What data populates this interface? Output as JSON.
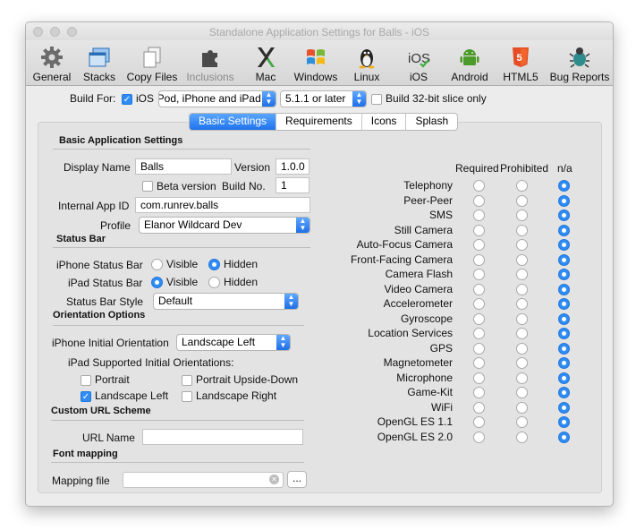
{
  "window": {
    "title": "Standalone Application Settings for Balls - iOS"
  },
  "toolbar": [
    {
      "label": "General",
      "icon": "gear-icon",
      "enabled": true
    },
    {
      "label": "Stacks",
      "icon": "stacks-icon",
      "enabled": true
    },
    {
      "label": "Copy Files",
      "icon": "copy-files-icon",
      "enabled": true
    },
    {
      "label": "Inclusions",
      "icon": "puzzle-icon",
      "enabled": false
    },
    {
      "label": "Mac",
      "icon": "mac-x-icon",
      "enabled": true
    },
    {
      "label": "Windows",
      "icon": "windows-icon",
      "enabled": true
    },
    {
      "label": "Linux",
      "icon": "linux-penguin-icon",
      "enabled": true
    },
    {
      "label": "iOS",
      "icon": "ios-icon",
      "enabled": true
    },
    {
      "label": "Android",
      "icon": "android-icon",
      "enabled": true
    },
    {
      "label": "HTML5",
      "icon": "html5-icon",
      "enabled": true
    },
    {
      "label": "Bug Reports",
      "icon": "bug-icon",
      "enabled": true
    }
  ],
  "build": {
    "label": "Build For:",
    "ios_label": "iOS",
    "device_value": "iPod, iPhone and iPad",
    "version_value": "5.1.1 or later",
    "slice_label": "Build 32-bit slice only"
  },
  "tabs": [
    "Basic Settings",
    "Requirements",
    "Icons",
    "Splash"
  ],
  "basic": {
    "heading": "Basic Application Settings",
    "display_name_label": "Display Name",
    "display_name_value": "Balls",
    "version_label": "Version",
    "version_value": "1.0.0",
    "beta_label": "Beta version",
    "build_no_label": "Build No.",
    "build_no_value": "1",
    "app_id_label": "Internal App ID",
    "app_id_value": "com.runrev.balls",
    "profile_label": "Profile",
    "profile_value": "Elanor Wildcard Dev"
  },
  "status_bar": {
    "heading": "Status Bar",
    "iphone_label": "iPhone Status Bar",
    "ipad_label": "iPad Status Bar",
    "visible_label": "Visible",
    "hidden_label": "Hidden",
    "style_label": "Status Bar Style",
    "style_value": "Default"
  },
  "orientation": {
    "heading": "Orientation Options",
    "iphone_initial_label": "iPhone Initial Orientation",
    "iphone_initial_value": "Landscape Left",
    "ipad_supported_label": "iPad Supported Initial Orientations:",
    "portrait": "Portrait",
    "portrait_upside_down": "Portrait Upside-Down",
    "landscape_left": "Landscape Left",
    "landscape_right": "Landscape Right"
  },
  "url_scheme": {
    "heading": "Custom URL Scheme",
    "url_name_label": "URL Name"
  },
  "font_mapping": {
    "heading": "Font mapping",
    "mapping_file_label": "Mapping file",
    "browse_label": "..."
  },
  "requirements": {
    "columns": [
      "Required",
      "Prohibited",
      "n/a"
    ],
    "rows": [
      "Telephony",
      "Peer-Peer",
      "SMS",
      "Still Camera",
      "Auto-Focus Camera",
      "Front-Facing Camera",
      "Camera Flash",
      "Video Camera",
      "Accelerometer",
      "Gyroscope",
      "Location Services",
      "GPS",
      "Magnetometer",
      "Microphone",
      "Game-Kit",
      "WiFi",
      "OpenGL ES 1.1",
      "OpenGL ES 2.0"
    ]
  },
  "colors": {
    "accent": "#2e8cf4",
    "window_bg": "#ececec",
    "panel_bg": "#e3e3e3"
  }
}
